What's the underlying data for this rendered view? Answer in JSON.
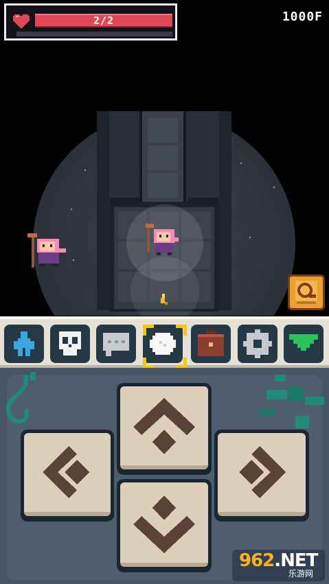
{
  "hud": {
    "hp_text": "2/2",
    "hp_fraction": 1.0,
    "floor": "1000F"
  },
  "toolbar": {
    "items": [
      {
        "name": "character",
        "icon": "character-icon"
      },
      {
        "name": "skull",
        "icon": "skull-icon"
      },
      {
        "name": "chat",
        "icon": "speech-bubble-icon"
      },
      {
        "name": "map",
        "icon": "cloud-map-icon",
        "selected": true
      },
      {
        "name": "inventory",
        "icon": "backpack-icon"
      },
      {
        "name": "settings",
        "icon": "gear-icon"
      },
      {
        "name": "collapse",
        "icon": "triangle-down-icon"
      }
    ]
  },
  "watermark": {
    "main": "962",
    "suffix": ".NET",
    "sub": "乐游网"
  },
  "colors": {
    "hp": "#e04759",
    "toolbar_bg": "#e6e1d7",
    "button_face": "#ddd0bb",
    "dpad_bg": "#455566",
    "accent": "#f5c518"
  }
}
